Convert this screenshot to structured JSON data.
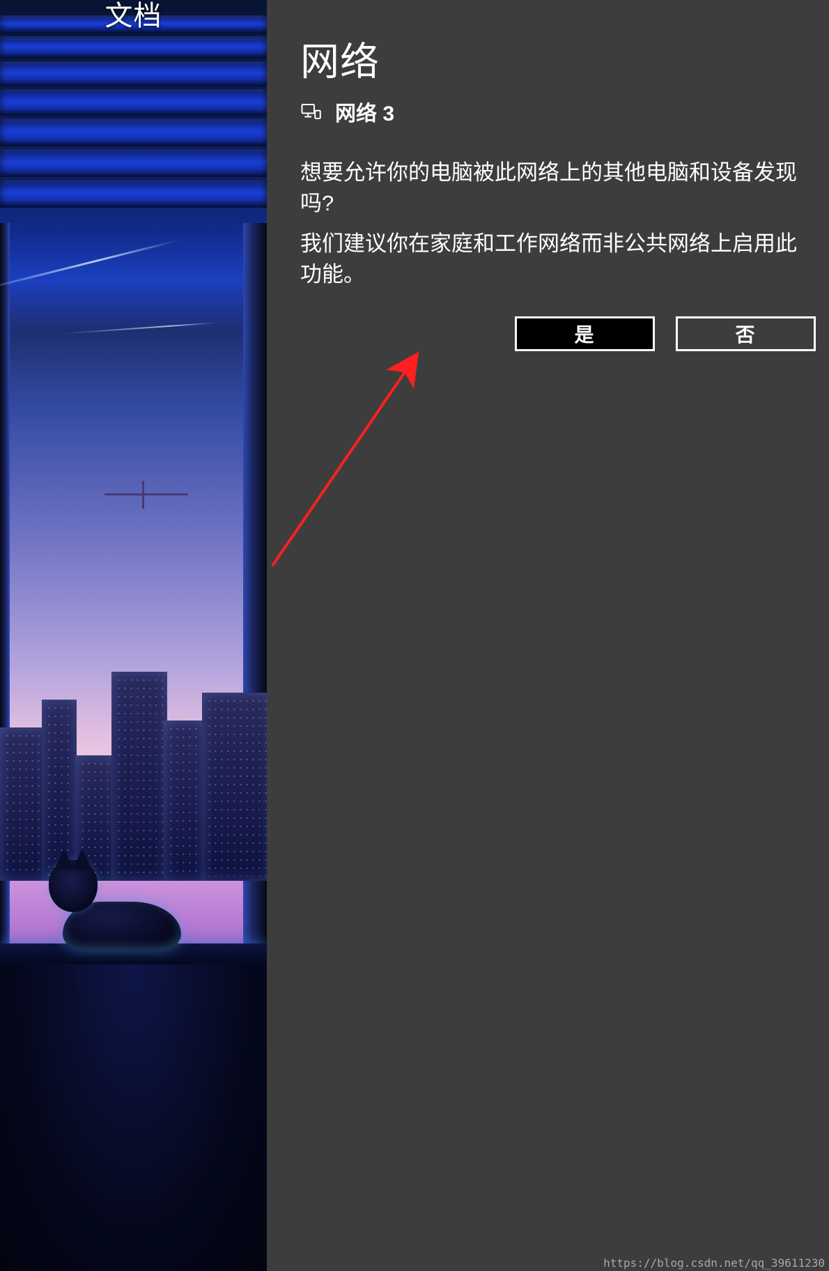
{
  "desktop": {
    "folder_label": "文档"
  },
  "panel": {
    "title": "网络",
    "network_name": "网络 3",
    "question_line": "想要允许你的电脑被此网络上的其他电脑和设备发现吗?",
    "recommendation_line": "我们建议你在家庭和工作网络而非公共网络上启用此功能。",
    "yes_label": "是",
    "no_label": "否"
  },
  "watermark": "https://blog.csdn.net/qq_39611230",
  "colors": {
    "panel_bg": "#3d3d3d",
    "button_yes_bg": "#000000",
    "arrow": "#ff1f1f"
  }
}
